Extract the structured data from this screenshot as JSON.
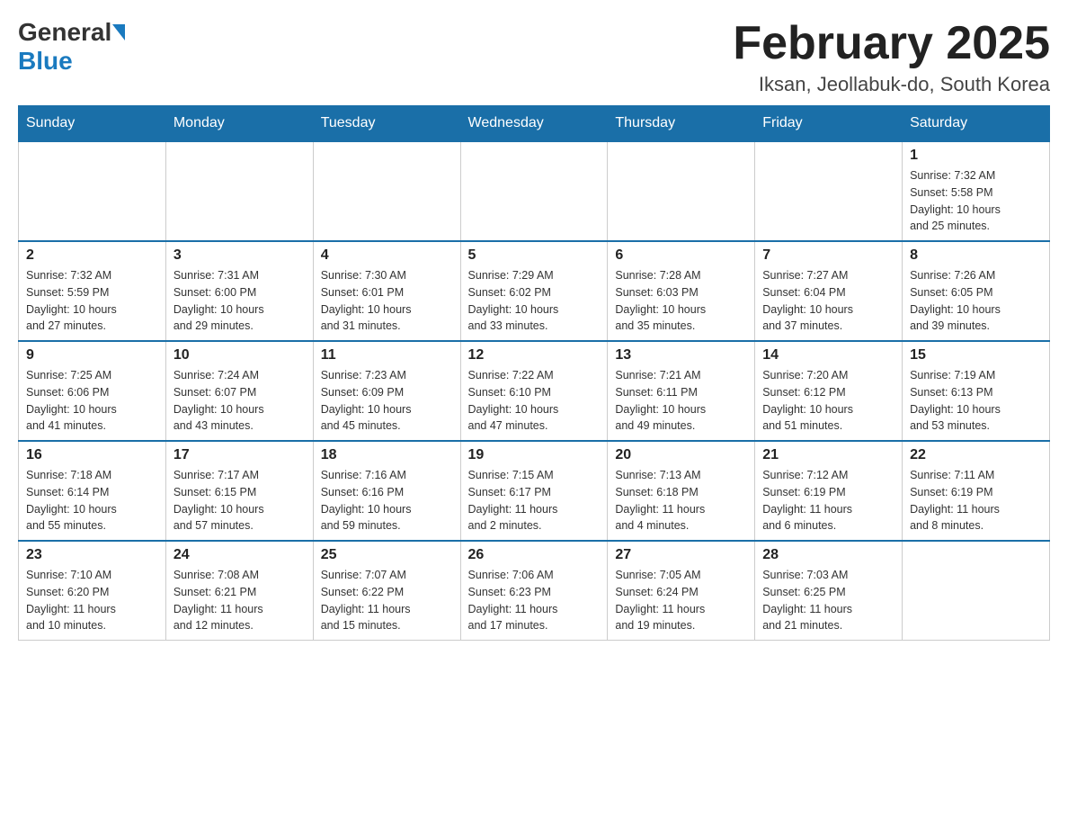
{
  "header": {
    "logo_general": "General",
    "logo_blue": "Blue",
    "title": "February 2025",
    "location": "Iksan, Jeollabuk-do, South Korea"
  },
  "days_of_week": [
    "Sunday",
    "Monday",
    "Tuesday",
    "Wednesday",
    "Thursday",
    "Friday",
    "Saturday"
  ],
  "weeks": [
    {
      "days": [
        {
          "num": "",
          "info": ""
        },
        {
          "num": "",
          "info": ""
        },
        {
          "num": "",
          "info": ""
        },
        {
          "num": "",
          "info": ""
        },
        {
          "num": "",
          "info": ""
        },
        {
          "num": "",
          "info": ""
        },
        {
          "num": "1",
          "info": "Sunrise: 7:32 AM\nSunset: 5:58 PM\nDaylight: 10 hours\nand 25 minutes."
        }
      ]
    },
    {
      "days": [
        {
          "num": "2",
          "info": "Sunrise: 7:32 AM\nSunset: 5:59 PM\nDaylight: 10 hours\nand 27 minutes."
        },
        {
          "num": "3",
          "info": "Sunrise: 7:31 AM\nSunset: 6:00 PM\nDaylight: 10 hours\nand 29 minutes."
        },
        {
          "num": "4",
          "info": "Sunrise: 7:30 AM\nSunset: 6:01 PM\nDaylight: 10 hours\nand 31 minutes."
        },
        {
          "num": "5",
          "info": "Sunrise: 7:29 AM\nSunset: 6:02 PM\nDaylight: 10 hours\nand 33 minutes."
        },
        {
          "num": "6",
          "info": "Sunrise: 7:28 AM\nSunset: 6:03 PM\nDaylight: 10 hours\nand 35 minutes."
        },
        {
          "num": "7",
          "info": "Sunrise: 7:27 AM\nSunset: 6:04 PM\nDaylight: 10 hours\nand 37 minutes."
        },
        {
          "num": "8",
          "info": "Sunrise: 7:26 AM\nSunset: 6:05 PM\nDaylight: 10 hours\nand 39 minutes."
        }
      ]
    },
    {
      "days": [
        {
          "num": "9",
          "info": "Sunrise: 7:25 AM\nSunset: 6:06 PM\nDaylight: 10 hours\nand 41 minutes."
        },
        {
          "num": "10",
          "info": "Sunrise: 7:24 AM\nSunset: 6:07 PM\nDaylight: 10 hours\nand 43 minutes."
        },
        {
          "num": "11",
          "info": "Sunrise: 7:23 AM\nSunset: 6:09 PM\nDaylight: 10 hours\nand 45 minutes."
        },
        {
          "num": "12",
          "info": "Sunrise: 7:22 AM\nSunset: 6:10 PM\nDaylight: 10 hours\nand 47 minutes."
        },
        {
          "num": "13",
          "info": "Sunrise: 7:21 AM\nSunset: 6:11 PM\nDaylight: 10 hours\nand 49 minutes."
        },
        {
          "num": "14",
          "info": "Sunrise: 7:20 AM\nSunset: 6:12 PM\nDaylight: 10 hours\nand 51 minutes."
        },
        {
          "num": "15",
          "info": "Sunrise: 7:19 AM\nSunset: 6:13 PM\nDaylight: 10 hours\nand 53 minutes."
        }
      ]
    },
    {
      "days": [
        {
          "num": "16",
          "info": "Sunrise: 7:18 AM\nSunset: 6:14 PM\nDaylight: 10 hours\nand 55 minutes."
        },
        {
          "num": "17",
          "info": "Sunrise: 7:17 AM\nSunset: 6:15 PM\nDaylight: 10 hours\nand 57 minutes."
        },
        {
          "num": "18",
          "info": "Sunrise: 7:16 AM\nSunset: 6:16 PM\nDaylight: 10 hours\nand 59 minutes."
        },
        {
          "num": "19",
          "info": "Sunrise: 7:15 AM\nSunset: 6:17 PM\nDaylight: 11 hours\nand 2 minutes."
        },
        {
          "num": "20",
          "info": "Sunrise: 7:13 AM\nSunset: 6:18 PM\nDaylight: 11 hours\nand 4 minutes."
        },
        {
          "num": "21",
          "info": "Sunrise: 7:12 AM\nSunset: 6:19 PM\nDaylight: 11 hours\nand 6 minutes."
        },
        {
          "num": "22",
          "info": "Sunrise: 7:11 AM\nSunset: 6:19 PM\nDaylight: 11 hours\nand 8 minutes."
        }
      ]
    },
    {
      "days": [
        {
          "num": "23",
          "info": "Sunrise: 7:10 AM\nSunset: 6:20 PM\nDaylight: 11 hours\nand 10 minutes."
        },
        {
          "num": "24",
          "info": "Sunrise: 7:08 AM\nSunset: 6:21 PM\nDaylight: 11 hours\nand 12 minutes."
        },
        {
          "num": "25",
          "info": "Sunrise: 7:07 AM\nSunset: 6:22 PM\nDaylight: 11 hours\nand 15 minutes."
        },
        {
          "num": "26",
          "info": "Sunrise: 7:06 AM\nSunset: 6:23 PM\nDaylight: 11 hours\nand 17 minutes."
        },
        {
          "num": "27",
          "info": "Sunrise: 7:05 AM\nSunset: 6:24 PM\nDaylight: 11 hours\nand 19 minutes."
        },
        {
          "num": "28",
          "info": "Sunrise: 7:03 AM\nSunset: 6:25 PM\nDaylight: 11 hours\nand 21 minutes."
        },
        {
          "num": "",
          "info": ""
        }
      ]
    }
  ]
}
